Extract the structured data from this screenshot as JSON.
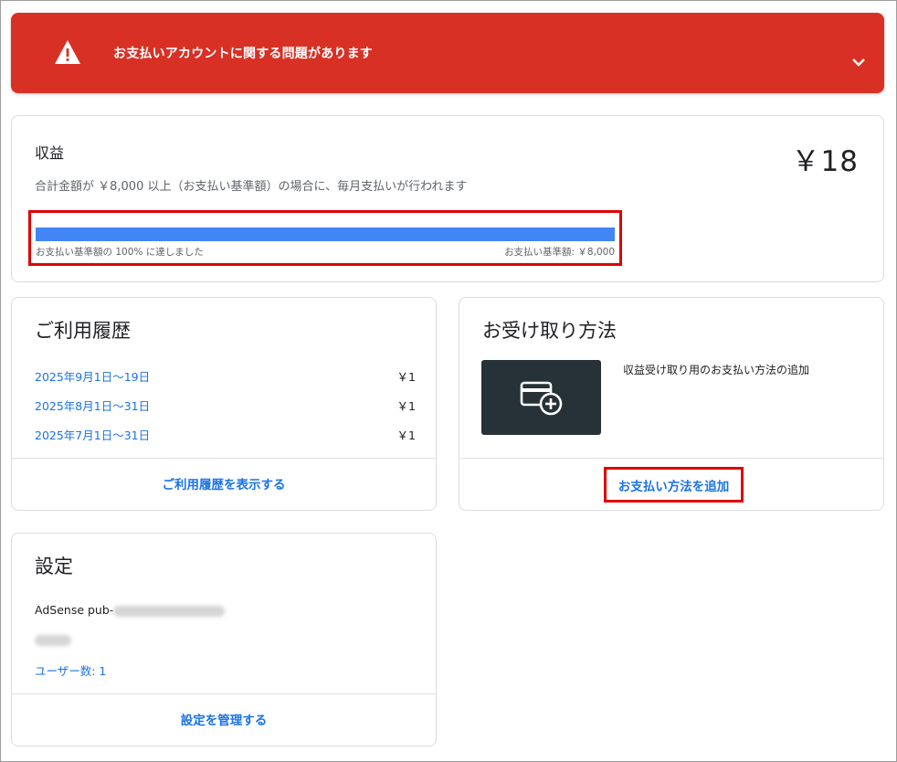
{
  "alert": {
    "text": "お支払いアカウントに関する問題があります",
    "bg_color": "#d93025",
    "icon": "warning-icon",
    "expand_icon": "chevron-down-icon"
  },
  "earnings": {
    "title": "収益",
    "amount": "￥18",
    "subtitle": "合計金額が ￥8,000 以上（お支払い基準額）の場合に、毎月支払いが行われます",
    "progress": {
      "percent": 100,
      "left_label": "お支払い基準額の 100% に達しました",
      "right_label": "お支払い基準額: ￥8,000",
      "fill_color": "#4285f4"
    }
  },
  "history": {
    "title": "ご利用履歴",
    "rows": [
      {
        "period": "2025年9月1日〜19日",
        "amount": "￥1"
      },
      {
        "period": "2025年8月1日〜31日",
        "amount": "￥1"
      },
      {
        "period": "2025年7月1日〜31日",
        "amount": "￥1"
      }
    ],
    "footer_link": "ご利用履歴を表示する"
  },
  "payment": {
    "title": "お受け取り方法",
    "description": "収益受け取り用のお支払い方法の追加",
    "tile_icon": "add-card-icon",
    "footer_link": "お支払い方法を追加"
  },
  "settings": {
    "title": "設定",
    "publisher_prefix": "AdSense pub-",
    "user_count": "ユーザー数: 1",
    "footer_link": "設定を管理する"
  },
  "colors": {
    "link": "#1a73e8",
    "highlight_border": "#e00000",
    "tile_bg": "#263238"
  }
}
